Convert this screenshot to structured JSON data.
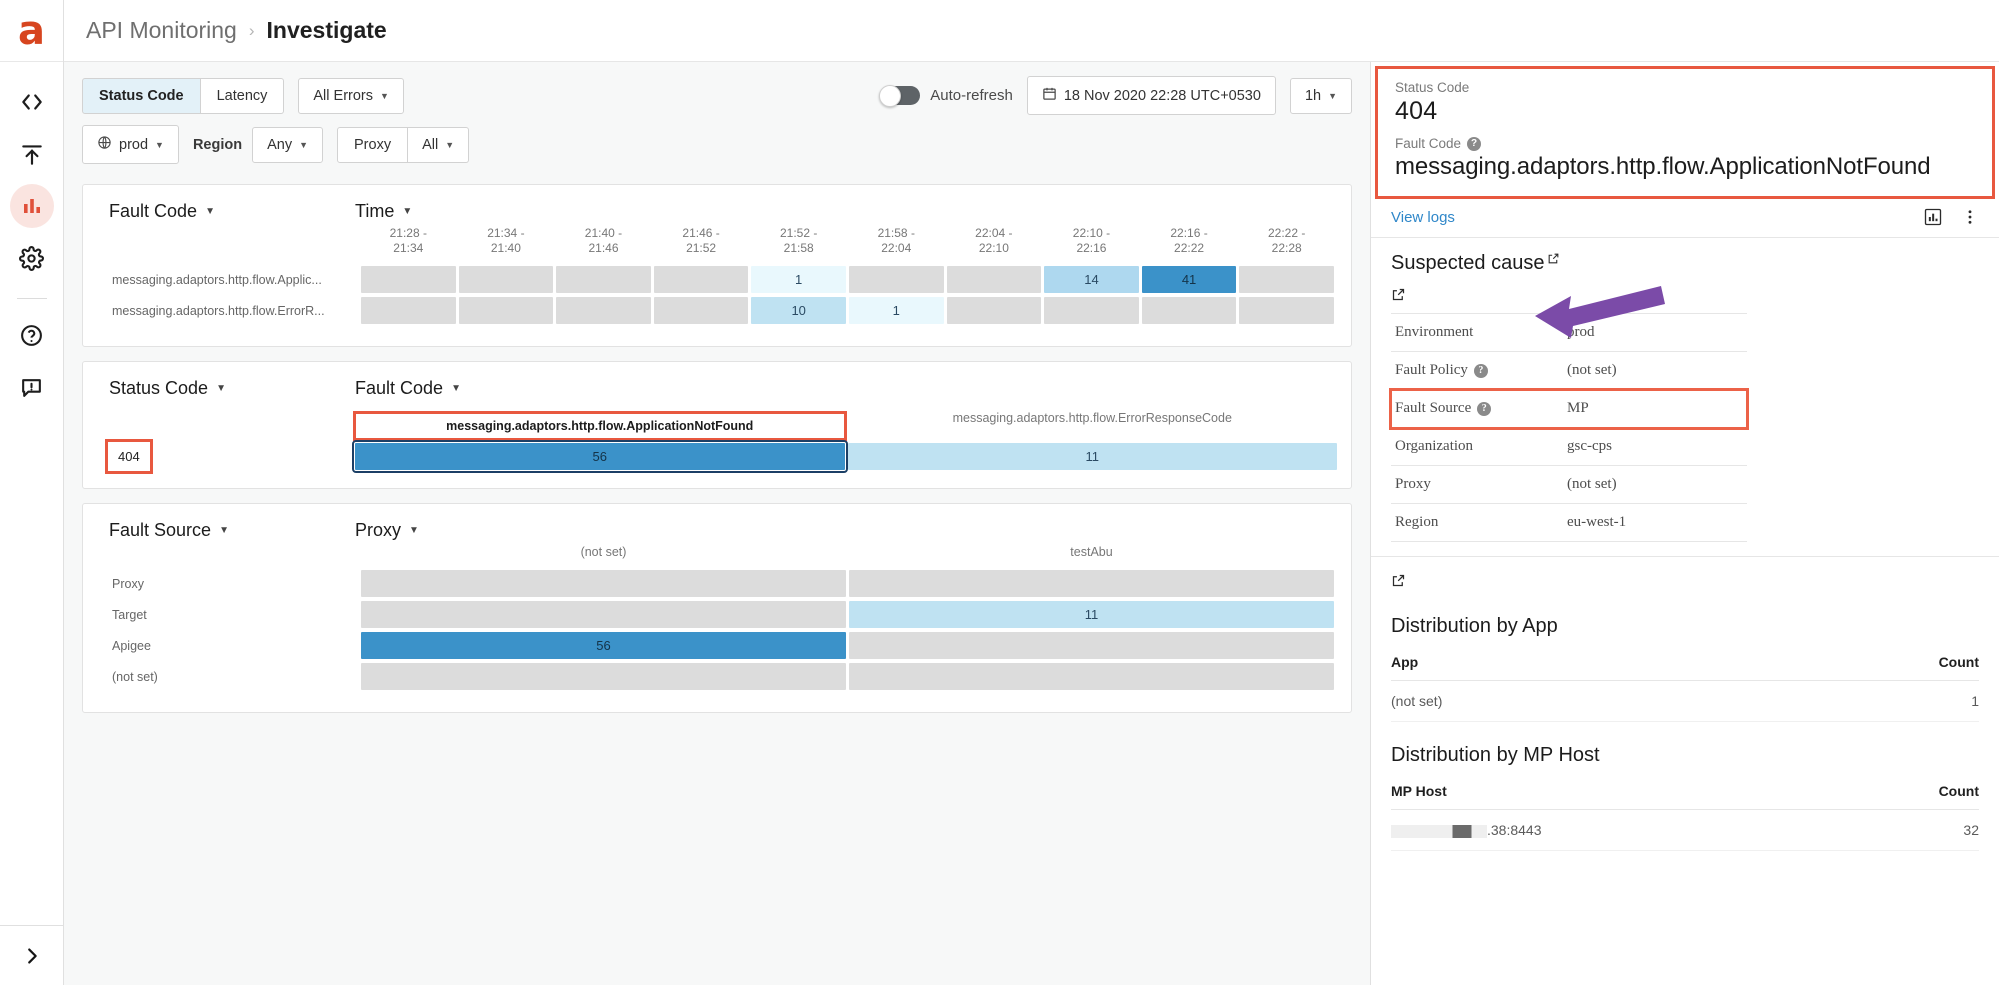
{
  "app": {
    "logo": "apigee-logo",
    "brand_color": "#d7451f"
  },
  "rail": {
    "items": [
      {
        "name": "develop-icon",
        "glyph": "< >"
      },
      {
        "name": "publish-icon",
        "glyph": "upload"
      },
      {
        "name": "analyze-icon",
        "glyph": "bar-chart",
        "active": true
      },
      {
        "name": "admin-icon",
        "glyph": "gear"
      },
      {
        "name": "help-icon",
        "glyph": "question-circle"
      },
      {
        "name": "feedback-icon",
        "glyph": "comment-alert"
      }
    ],
    "expand_glyph": "›"
  },
  "breadcrumb": {
    "parent": "API Monitoring",
    "separator": "›",
    "current": "Investigate"
  },
  "filters": {
    "tabs": [
      {
        "label": "Status Code",
        "selected": true
      },
      {
        "label": "Latency",
        "selected": false
      }
    ],
    "error_filter": "All Errors",
    "env": "prod",
    "region_label": "Region",
    "region_value": "Any",
    "proxy_label": "Proxy",
    "proxy_value": "All",
    "auto_refresh_label": "Auto-refresh",
    "auto_refresh_on": false,
    "date_range": "18 Nov 2020 22:28 UTC+0530",
    "duration": "1h"
  },
  "chart_data": [
    {
      "type": "heatmap",
      "title": "Fault Code by Time",
      "row_dimension": "Fault Code",
      "col_dimension": "Time",
      "categories": [
        "21:28 -\n21:34",
        "21:34 -\n21:40",
        "21:40 -\n21:46",
        "21:46 -\n21:52",
        "21:52 -\n21:58",
        "21:58 -\n22:04",
        "22:04 -\n22:10",
        "22:10 -\n22:16",
        "22:16 -\n22:22",
        "22:22 -\n22:28"
      ],
      "rows": [
        {
          "label": "messaging.adaptors.http.flow.Applic...",
          "values": [
            null,
            null,
            null,
            null,
            1,
            null,
            null,
            14,
            41,
            null
          ]
        },
        {
          "label": "messaging.adaptors.http.flow.ErrorR...",
          "values": [
            null,
            null,
            null,
            null,
            10,
            1,
            null,
            null,
            null,
            null
          ]
        }
      ]
    },
    {
      "type": "heatmap",
      "title": "Status Code by Fault Code",
      "row_dimension": "Status Code",
      "col_dimension": "Fault Code",
      "categories": [
        "messaging.adaptors.http.flow.ApplicationNotFound",
        "messaging.adaptors.http.flow.ErrorResponseCode"
      ],
      "rows": [
        {
          "label": "404",
          "values": [
            56,
            11
          ]
        }
      ]
    },
    {
      "type": "heatmap",
      "title": "Fault Source by Proxy",
      "row_dimension": "Fault Source",
      "col_dimension": "Proxy",
      "categories": [
        "(not set)",
        "testAbu"
      ],
      "rows": [
        {
          "label": "Proxy",
          "values": [
            null,
            null
          ]
        },
        {
          "label": "Target",
          "values": [
            null,
            11
          ]
        },
        {
          "label": "Apigee",
          "values": [
            56,
            null
          ]
        },
        {
          "label": "(not set)",
          "values": [
            null,
            null
          ]
        }
      ]
    }
  ],
  "detail": {
    "status_code_label": "Status Code",
    "status_code_value": "404",
    "fault_code_label": "Fault Code",
    "fault_code_value": "messaging.adaptors.http.flow.ApplicationNotFound",
    "view_logs": "View logs",
    "chart_icon": "bar-chart-icon",
    "more_icon": "kebab-menu-icon",
    "suspected_cause_title": "Suspected cause",
    "attributes": [
      {
        "key": "Environment",
        "value": "prod",
        "help": false
      },
      {
        "key": "Fault Policy",
        "value": "(not set)",
        "help": true
      },
      {
        "key": "Fault Source",
        "value": "MP",
        "help": true,
        "highlight": true
      },
      {
        "key": "Organization",
        "value": "gsc-cps",
        "help": false
      },
      {
        "key": "Proxy",
        "value": "(not set)",
        "help": false
      },
      {
        "key": "Region",
        "value": "eu-west-1",
        "help": false
      }
    ],
    "dist_app": {
      "title": "Distribution by App",
      "columns": [
        "App",
        "Count"
      ],
      "rows": [
        {
          "name": "(not set)",
          "count": "1"
        }
      ]
    },
    "dist_mp_host": {
      "title": "Distribution by MP Host",
      "columns": [
        "MP Host",
        "Count"
      ],
      "rows": [
        {
          "name": ".38:8443",
          "count": "32",
          "redacted": true
        }
      ]
    }
  },
  "annotations": {
    "highlight_color": "#ec6248",
    "arrow_color": "#7b4ba8"
  }
}
